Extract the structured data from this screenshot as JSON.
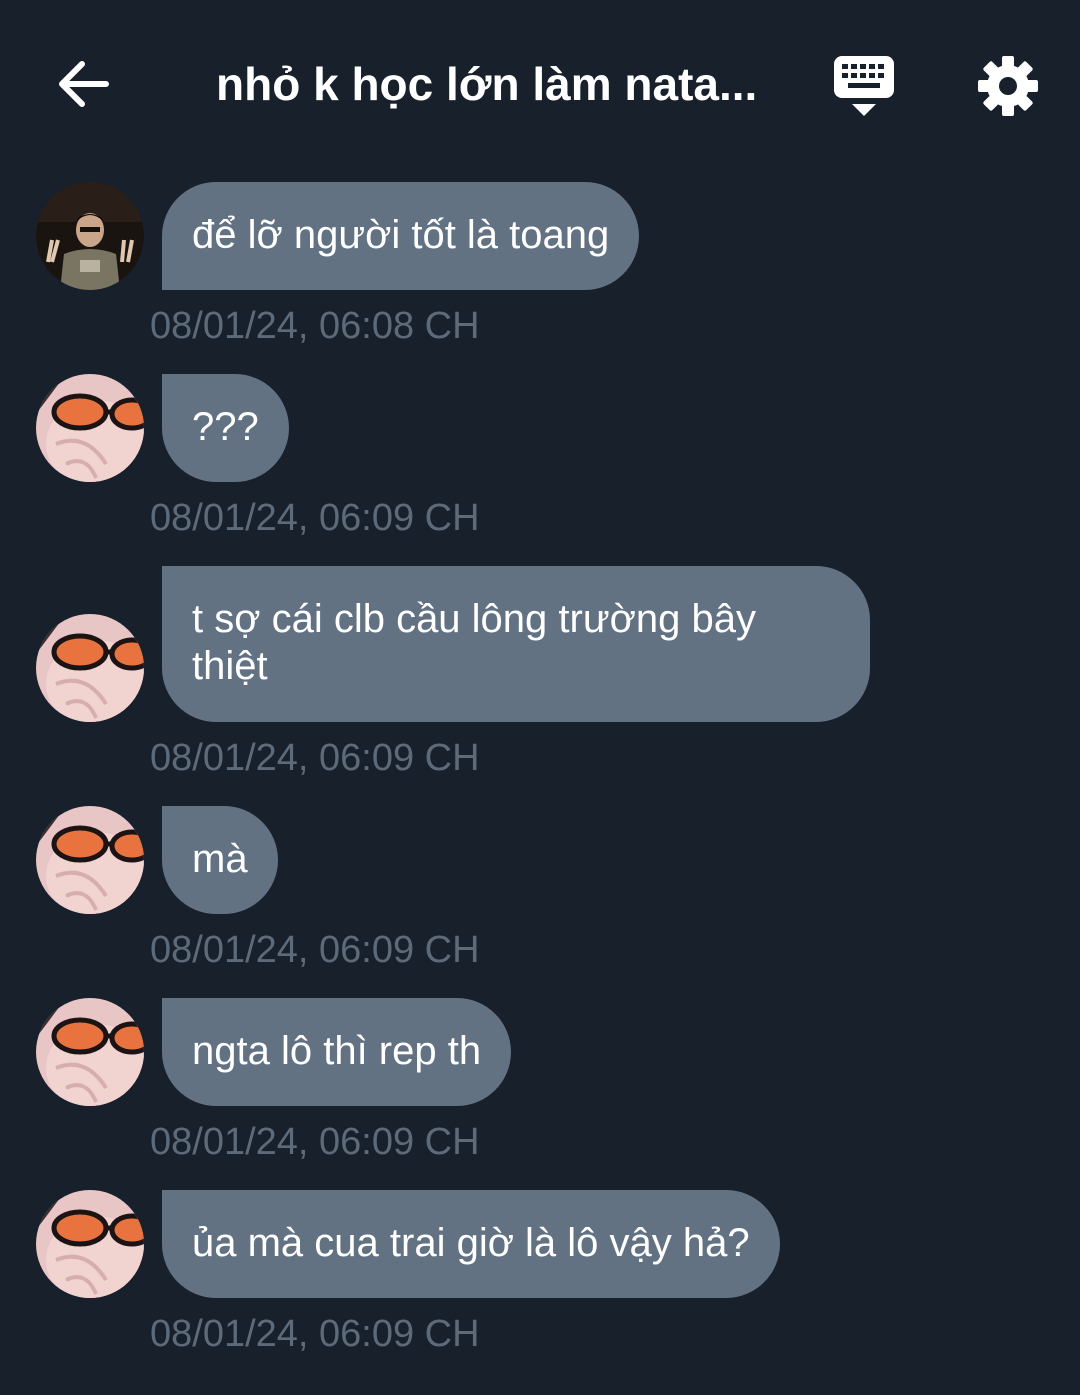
{
  "header": {
    "title": "nhỏ k học lớn làm nata...",
    "back_icon": "arrow-left-icon",
    "keyboard_icon": "keyboard-icon",
    "settings_icon": "gear-icon"
  },
  "colors": {
    "background": "#17202b",
    "bubble": "#637283",
    "timestamp": "#5c6a7a",
    "text": "#ffffff"
  },
  "messages": [
    {
      "text": "để lỡ người tốt là toang",
      "time": "08/01/24, 06:08 CH",
      "sender": "friend-avatar"
    },
    {
      "text": "???",
      "time": "08/01/24, 06:09 CH",
      "sender": "user-avatar"
    },
    {
      "text": "t sợ cái clb cầu lông trường bây thiệt",
      "time": "08/01/24, 06:09 CH",
      "sender": "user-avatar"
    },
    {
      "text": "mà",
      "time": "08/01/24, 06:09 CH",
      "sender": "user-avatar"
    },
    {
      "text": "ngta lô thì rep th",
      "time": "08/01/24, 06:09 CH",
      "sender": "user-avatar"
    },
    {
      "text": "ủa mà cua trai giờ là lô vậy hả?",
      "time": "08/01/24, 06:09 CH",
      "sender": "user-avatar"
    }
  ]
}
